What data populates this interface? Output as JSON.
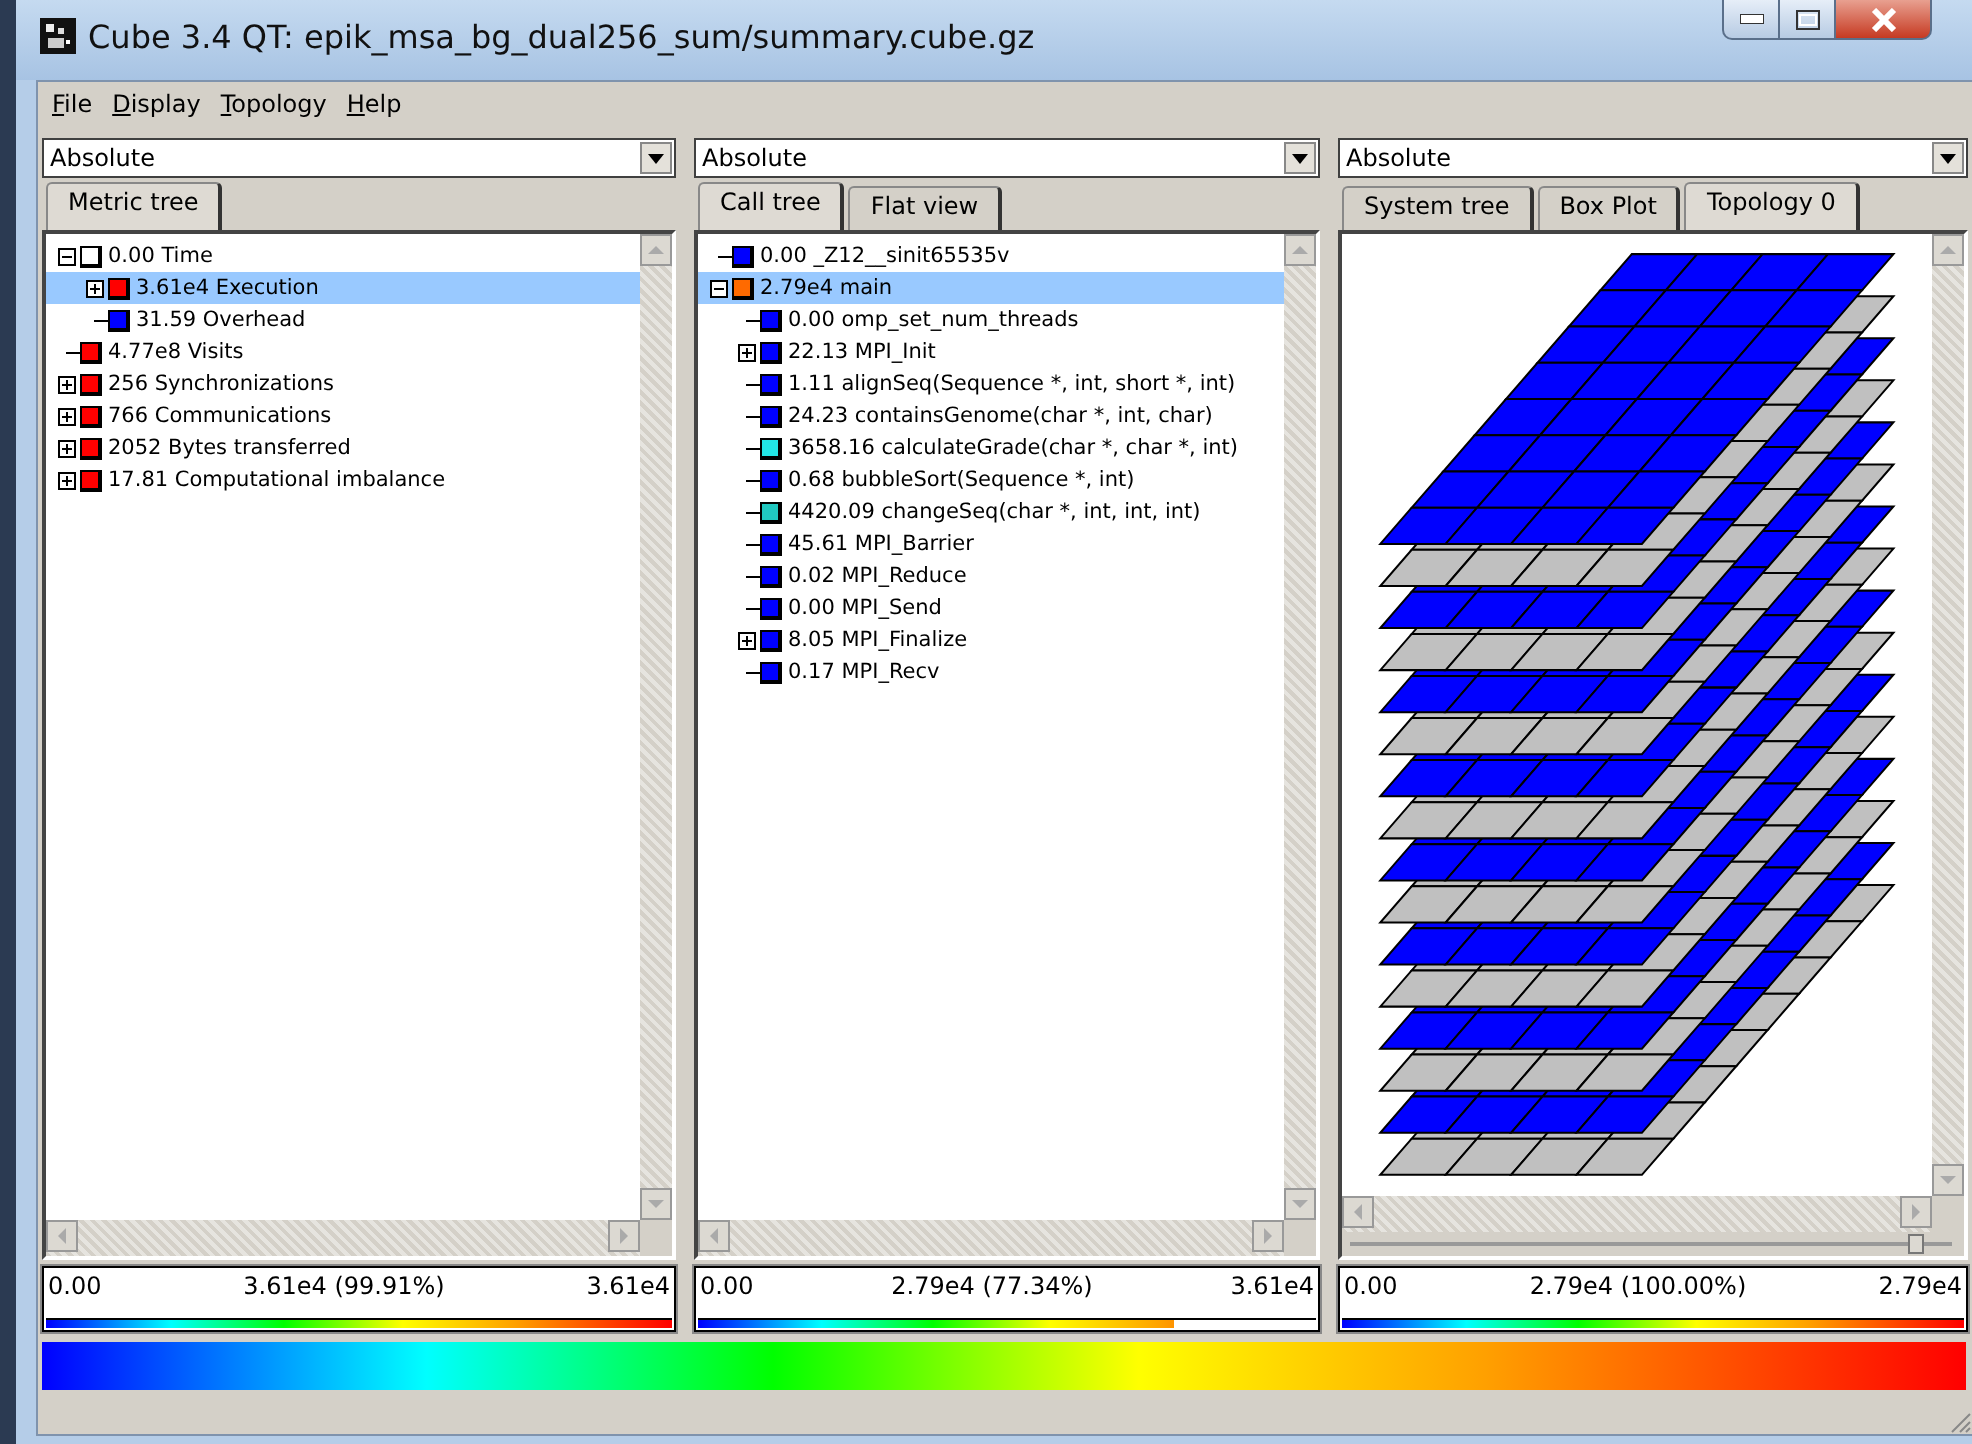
{
  "window": {
    "title": "Cube 3.4 QT: epik_msa_bg_dual256_sum/summary.cube.gz"
  },
  "menu": [
    "File",
    "Display",
    "Topology",
    "Help"
  ],
  "panels": [
    {
      "mode": "Absolute",
      "tabs": [
        {
          "label": "Metric tree",
          "selected": true
        }
      ],
      "view": {
        "kind": "tree",
        "items": [
          {
            "text": "0.00 Time",
            "color": "#ffffff",
            "expanded": true,
            "selected": false,
            "children": [
              {
                "text": "3.61e4 Execution",
                "color": "#ff0000",
                "expanded": false,
                "selected": true
              },
              {
                "text": "31.59 Overhead",
                "color": "#0000ff",
                "selected": false
              }
            ]
          },
          {
            "text": "4.77e8 Visits",
            "color": "#ff0000",
            "selected": false
          },
          {
            "text": "256 Synchronizations",
            "color": "#ff0000",
            "expanded": false,
            "selected": false
          },
          {
            "text": "766 Communications",
            "color": "#ff0000",
            "expanded": false,
            "selected": false
          },
          {
            "text": "2052 Bytes transferred",
            "color": "#ff0000",
            "expanded": false,
            "selected": false
          },
          {
            "text": "17.81 Computational imbalance",
            "color": "#ff0000",
            "expanded": false,
            "selected": false
          }
        ]
      },
      "value_bar": {
        "min": "0.00",
        "value": "3.61e4 (99.91%)",
        "max": "3.61e4",
        "level": 1
      }
    },
    {
      "mode": "Absolute",
      "tabs": [
        {
          "label": "Call tree",
          "selected": true
        },
        {
          "label": "Flat view",
          "selected": false
        }
      ],
      "view": {
        "kind": "tree",
        "items": [
          {
            "text": "0.00 _Z12__sinit65535v",
            "color": "#0000ff",
            "selected": false
          },
          {
            "text": "2.79e4 main",
            "color": "#ff6a00",
            "expanded": true,
            "selected": true,
            "children": [
              {
                "text": "0.00 omp_set_num_threads",
                "color": "#0000ff",
                "selected": false
              },
              {
                "text": "22.13 MPI_Init",
                "color": "#0000ff",
                "expanded": false,
                "selected": false
              },
              {
                "text": "1.11 alignSeq(Sequence *, int, short *, int)",
                "color": "#0000ff",
                "selected": false
              },
              {
                "text": "24.23 containsGenome(char *, int, char)",
                "color": "#0000ff",
                "selected": false
              },
              {
                "text": "3658.16 calculateGrade(char *, char *, int)",
                "color": "#22e6e6",
                "selected": false
              },
              {
                "text": "0.68 bubbleSort(Sequence *, int)",
                "color": "#0000ff",
                "selected": false
              },
              {
                "text": "4420.09 changeSeq(char *, int, int, int)",
                "color": "#20c8c0",
                "selected": false
              },
              {
                "text": "45.61 MPI_Barrier",
                "color": "#0000ff",
                "selected": false
              },
              {
                "text": "0.02 MPI_Reduce",
                "color": "#0000ff",
                "selected": false
              },
              {
                "text": "0.00 MPI_Send",
                "color": "#0000ff",
                "selected": false
              },
              {
                "text": "8.05 MPI_Finalize",
                "color": "#0000ff",
                "expanded": false,
                "selected": false
              },
              {
                "text": "0.17 MPI_Recv",
                "color": "#0000ff",
                "selected": false
              }
            ]
          }
        ]
      },
      "value_bar": {
        "min": "0.00",
        "value": "2.79e4 (77.34%)",
        "max": "3.61e4",
        "level": 0.77
      }
    },
    {
      "mode": "Absolute",
      "tabs": [
        {
          "label": "System tree",
          "selected": false
        },
        {
          "label": "Box Plot",
          "selected": false
        },
        {
          "label": "Topology 0",
          "selected": true
        }
      ],
      "view": {
        "kind": "topology",
        "zoom_slider": {
          "level": 0.94
        }
      },
      "value_bar": {
        "min": "0.00",
        "value": "2.79e4 (100.00%)",
        "max": "2.79e4",
        "level": 1
      }
    }
  ]
}
